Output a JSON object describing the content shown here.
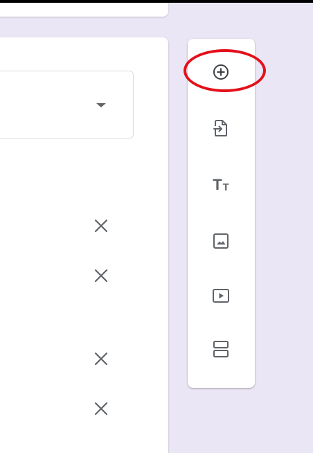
{
  "question": {
    "remove_option_icon": "close-icon",
    "option_count": 4
  },
  "toolbar": {
    "add_question": {
      "icon": "add-circle-icon"
    },
    "import_questions": {
      "icon": "import-file-icon"
    },
    "add_title_description": {
      "icon": "title-text-icon",
      "glyph_large": "T",
      "glyph_small": "T"
    },
    "add_image": {
      "icon": "image-icon"
    },
    "add_video": {
      "icon": "video-icon"
    },
    "add_section": {
      "icon": "section-icon"
    }
  },
  "colors": {
    "background": "#eae6f6",
    "card": "#ffffff",
    "icon": "#5f6368",
    "highlight": "#e3101a"
  }
}
